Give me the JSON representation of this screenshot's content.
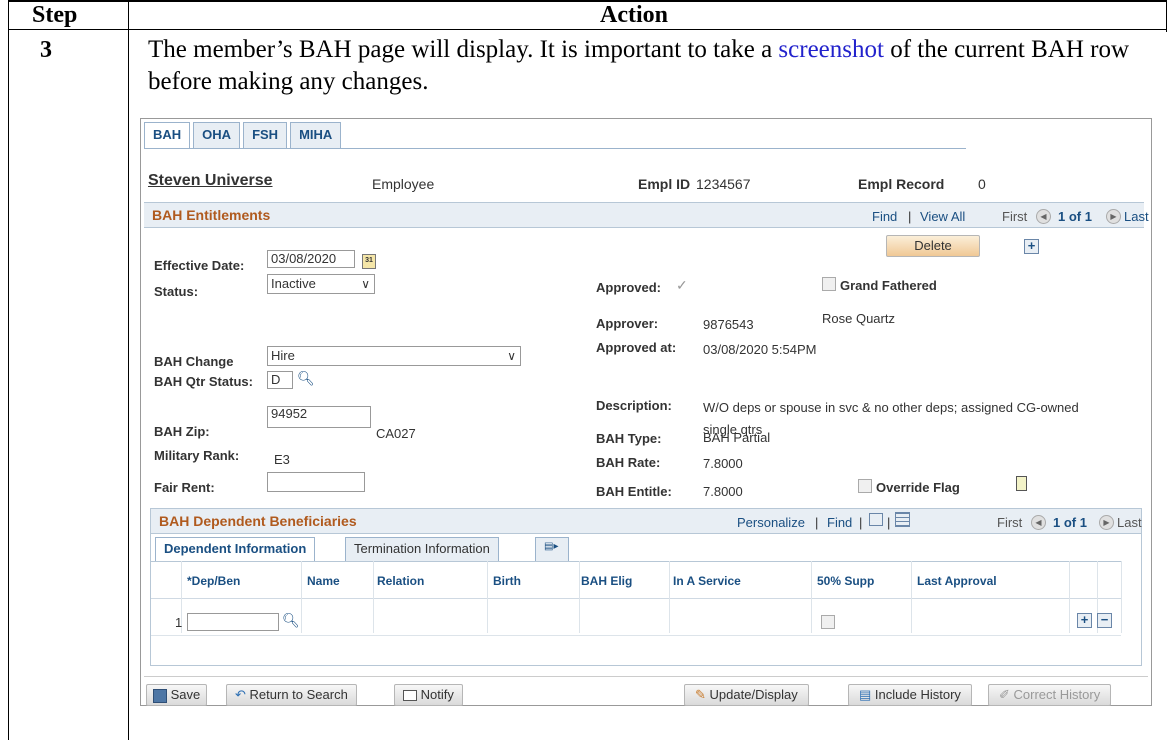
{
  "doc": {
    "col_step": "Step",
    "col_action": "Action",
    "step_number": "3",
    "instruction_pre": "The member’s BAH page will display.  It is important to take a ",
    "instruction_link": "screenshot",
    "instruction_post": " of the current BAH row before making any changes."
  },
  "tabs": [
    "BAH",
    "OHA",
    "FSH",
    "MIHA"
  ],
  "employee": {
    "name": "Steven Universe",
    "role": "Employee",
    "empl_id_label": "Empl ID",
    "empl_id": "1234567",
    "empl_record_label": "Empl Record",
    "empl_record": "0"
  },
  "entitlements": {
    "title": "BAH Entitlements",
    "find": "Find",
    "sep": "|",
    "view_all": "View All",
    "first": "First",
    "count": "1 of 1",
    "last": "Last",
    "delete_label": "Delete",
    "effective_date_label": "Effective Date:",
    "effective_date": "03/08/2020",
    "status_label": "Status:",
    "status": "Inactive",
    "approved_label": "Approved:",
    "grand_fathered_label": "Grand Fathered",
    "approver_label": "Approver:",
    "approver_id": "9876543",
    "approver_name": "Rose Quartz",
    "approved_at_label": "Approved at:",
    "approved_at": "03/08/2020  5:54PM",
    "bah_change_label": "BAH Change",
    "bah_change": "Hire",
    "bah_qtr_status_label": "BAH Qtr Status:",
    "bah_qtr_status": "D",
    "description_label": "Description:",
    "description_1": "W/O deps or spouse in svc & no other deps; assigned CG-owned",
    "description_2": "single qtrs",
    "bah_zip_label": "BAH Zip:",
    "bah_zip": "94952",
    "zip_code_area": "CA027",
    "bah_type_label": "BAH Type:",
    "bah_type": "BAH Partial",
    "military_rank_label": "Military Rank:",
    "military_rank": "E3",
    "bah_rate_label": "BAH Rate:",
    "bah_rate": "7.8000",
    "fair_rent_label": "Fair Rent:",
    "fair_rent": "",
    "bah_entitle_label": "BAH Entitle:",
    "bah_entitle": "7.8000",
    "override_flag_label": "Override Flag"
  },
  "dependents": {
    "title": "BAH Dependent Beneficiaries",
    "personalize": "Personalize",
    "find": "Find",
    "first": "First",
    "count": "1 of 1",
    "last": "Last",
    "tab_dependent": "Dependent Information",
    "tab_termination": "Termination Information",
    "columns": [
      "*Dep/Ben",
      "Name",
      "Relation",
      "Birth",
      "BAH Elig",
      "In A Service",
      "50% Supp",
      "Last Approval"
    ],
    "row_number": "1",
    "dep_ben_value": ""
  },
  "toolbar": {
    "save": "Save",
    "return_to_search": "Return to Search",
    "notify": "Notify",
    "update_display": "Update/Display",
    "include_history": "Include History",
    "correct_history": "Correct History"
  },
  "colors": {
    "section_title": "#b05a1e",
    "link": "#1a4f82",
    "section_bg": "#e8eef4"
  }
}
